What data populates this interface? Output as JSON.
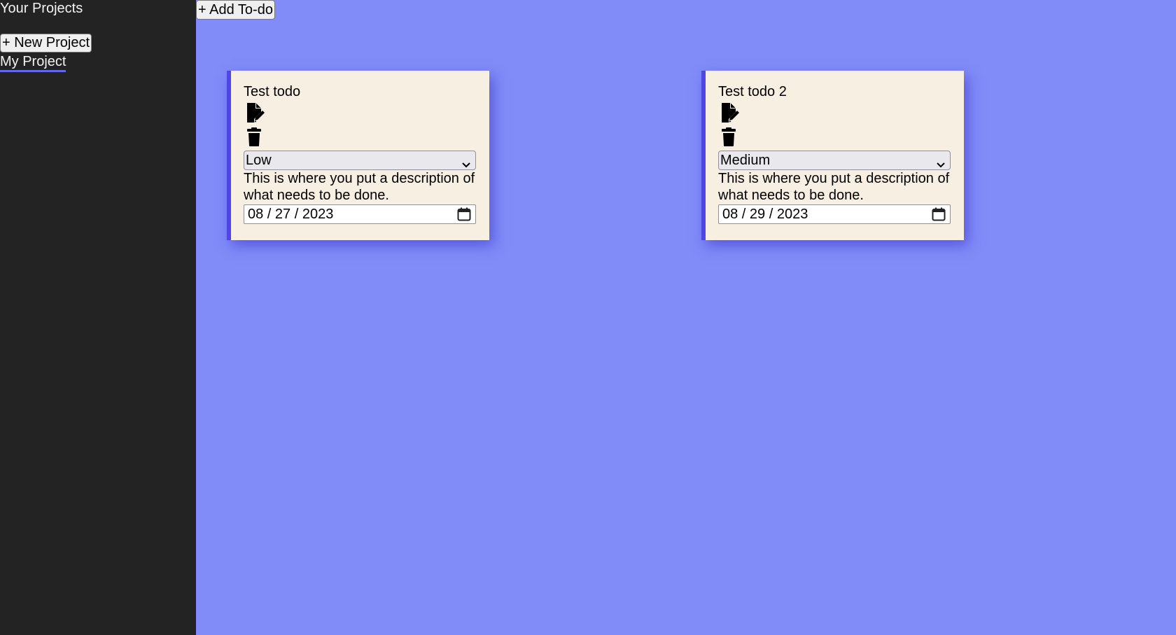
{
  "sidebar": {
    "title": "Your Projects",
    "new_project_label": "+ New Project",
    "projects": [
      {
        "label": "My Project"
      }
    ]
  },
  "main": {
    "add_todo_label": "+ Add To-do",
    "todos": [
      {
        "title": "Test todo",
        "priority": "Low",
        "description": "This is where you put a description of what needs to be done.",
        "due_date": "08 / 27 / 2023"
      },
      {
        "title": "Test todo 2",
        "priority": "Medium",
        "description": "This is where you put a description of what needs to be done.",
        "due_date": "08 / 29 / 2023"
      }
    ]
  },
  "icons": {
    "edit": "file-edit-icon",
    "delete": "trash-icon",
    "dropdown": "chevron-down-icon",
    "calendar": "calendar-icon"
  },
  "colors": {
    "sidebar_bg": "#232323",
    "main_bg": "#818cf8",
    "card_bg": "#f7efe2",
    "accent": "#4f46e5"
  }
}
